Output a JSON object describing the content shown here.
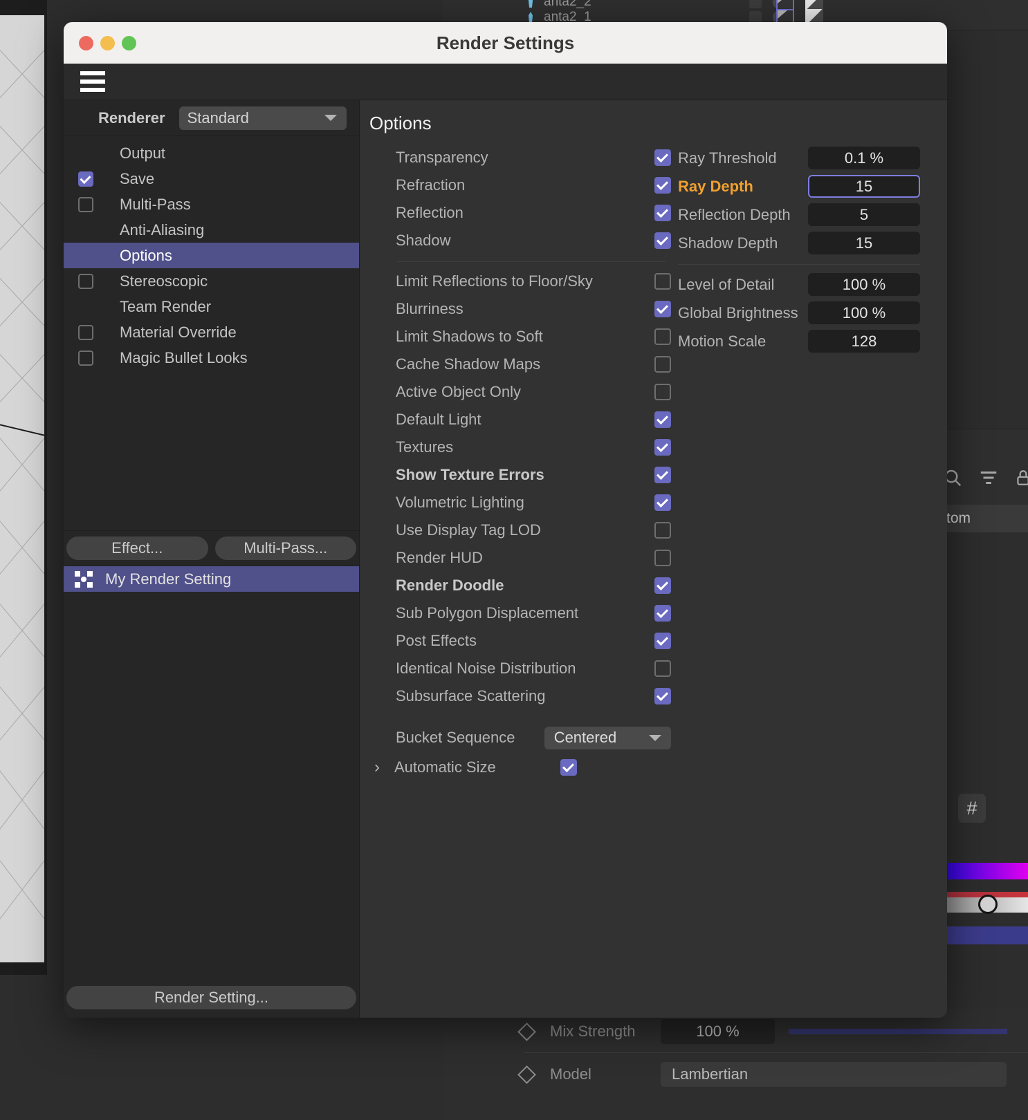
{
  "window": {
    "title": "Render Settings",
    "traffic_lights": [
      "close-button",
      "minimize-button",
      "maximize-button"
    ],
    "menu_icon": "hamburger-menu-icon"
  },
  "sidebar": {
    "renderer_label": "Renderer",
    "renderer_value": "Standard",
    "items": [
      {
        "label": "Output",
        "checkbox": "none"
      },
      {
        "label": "Save",
        "checkbox": "on"
      },
      {
        "label": "Multi-Pass",
        "checkbox": "off"
      },
      {
        "label": "Anti-Aliasing",
        "checkbox": "none"
      },
      {
        "label": "Options",
        "checkbox": "none",
        "selected": true
      },
      {
        "label": "Stereoscopic",
        "checkbox": "off"
      },
      {
        "label": "Team Render",
        "checkbox": "none"
      },
      {
        "label": "Material Override",
        "checkbox": "off"
      },
      {
        "label": "Magic Bullet Looks",
        "checkbox": "off"
      }
    ],
    "effect_button": "Effect...",
    "multipass_button": "Multi-Pass...",
    "preset": {
      "label": "My Render Setting",
      "icon": "render-target-icon",
      "selected": true
    },
    "render_setting_button": "Render Setting..."
  },
  "options": {
    "title": "Options",
    "group1": [
      {
        "label": "Transparency",
        "checked": true,
        "bold": false
      },
      {
        "label": "Refraction",
        "checked": true,
        "bold": false
      },
      {
        "label": "Reflection",
        "checked": true,
        "bold": false
      },
      {
        "label": "Shadow",
        "checked": true,
        "bold": false
      }
    ],
    "group2": [
      {
        "label": "Limit Reflections to Floor/Sky",
        "checked": false,
        "bold": false
      },
      {
        "label": "Blurriness",
        "checked": true,
        "bold": false
      },
      {
        "label": "Limit Shadows to Soft",
        "checked": false,
        "bold": false
      },
      {
        "label": "Cache Shadow Maps",
        "checked": false,
        "bold": false
      },
      {
        "label": "Active Object Only",
        "checked": false,
        "bold": false
      },
      {
        "label": "Default Light",
        "checked": true,
        "bold": false
      },
      {
        "label": "Textures",
        "checked": true,
        "bold": false
      },
      {
        "label": "Show Texture Errors",
        "checked": true,
        "bold": true
      },
      {
        "label": "Volumetric Lighting",
        "checked": true,
        "bold": false
      },
      {
        "label": "Use Display Tag LOD",
        "checked": false,
        "bold": false
      },
      {
        "label": "Render HUD",
        "checked": false,
        "bold": false
      },
      {
        "label": "Render Doodle",
        "checked": true,
        "bold": true
      },
      {
        "label": "Sub Polygon Displacement",
        "checked": true,
        "bold": false
      },
      {
        "label": "Post Effects",
        "checked": true,
        "bold": false
      },
      {
        "label": "Identical Noise Distribution",
        "checked": false,
        "bold": false
      },
      {
        "label": "Subsurface Scattering",
        "checked": true,
        "bold": false
      }
    ],
    "bucket_sequence_label": "Bucket Sequence",
    "bucket_sequence_value": "Centered",
    "automatic_size_label": "Automatic Size",
    "automatic_size_checked": true,
    "numbers_group1": [
      {
        "label": "Ray Threshold",
        "value": "0.1 %",
        "accent": false,
        "focused": false
      },
      {
        "label": "Ray Depth",
        "value": "15",
        "accent": true,
        "focused": true
      },
      {
        "label": "Reflection Depth",
        "value": "5",
        "accent": false,
        "focused": false
      },
      {
        "label": "Shadow Depth",
        "value": "15",
        "accent": false,
        "focused": false
      }
    ],
    "numbers_group2": [
      {
        "label": "Level of Detail",
        "value": "100 %",
        "accent": false,
        "focused": false
      },
      {
        "label": "Global Brightness",
        "value": "100 %",
        "accent": false,
        "focused": false
      },
      {
        "label": "Motion Scale",
        "value": "128",
        "accent": false,
        "focused": false
      }
    ]
  },
  "background": {
    "object_rows": [
      {
        "label": "anta2_2",
        "icon": "figure-icon"
      },
      {
        "label": "anta2_1",
        "icon": "figure-icon"
      }
    ],
    "toolbar_icons": [
      "search-icon",
      "filter-icon",
      "lock-icon"
    ],
    "breadcrumb": "tom",
    "hash_button": "#",
    "attributes": [
      {
        "label": "Mix Strength",
        "value": "100 %"
      },
      {
        "label": "Model",
        "value": "Lambertian"
      }
    ]
  },
  "colors": {
    "accent_orange": "#f0a030",
    "accent_purple": "#6a6ac0",
    "selection": "#50508a",
    "focus_border": "#7d7de0",
    "window_bg": "#2b2b2b",
    "content_bg": "#323232",
    "sidebar_bg": "#262626"
  }
}
